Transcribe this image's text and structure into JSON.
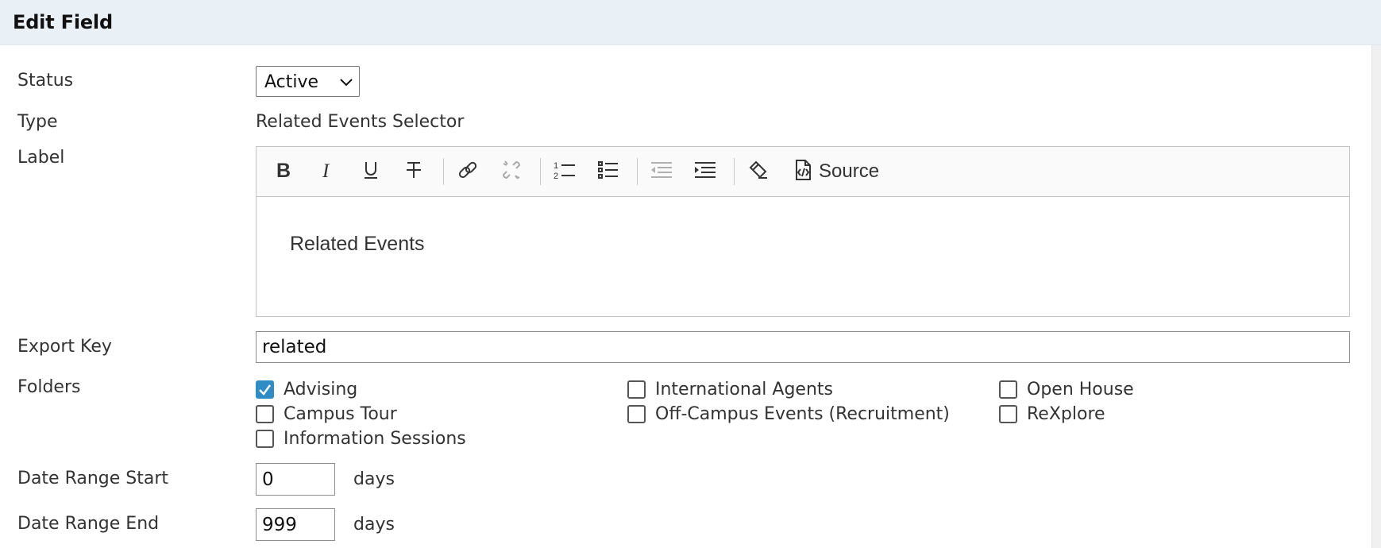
{
  "header": {
    "title": "Edit Field"
  },
  "status": {
    "label": "Status",
    "value": "Active",
    "accent": "#2f8cc4"
  },
  "type": {
    "label": "Type",
    "value": "Related Events Selector"
  },
  "label_field": {
    "label": "Label",
    "toolbar": {
      "buttons": [
        "bold",
        "italic",
        "underline",
        "strikethrough",
        "link",
        "unlink",
        "numbered-list",
        "bulleted-list",
        "outdent",
        "indent",
        "remove-format"
      ],
      "source_label": "Source"
    },
    "content": "Related Events"
  },
  "export_key": {
    "label": "Export Key",
    "value": "related"
  },
  "folders": {
    "label": "Folders",
    "items": [
      {
        "label": "Advising",
        "checked": true
      },
      {
        "label": "Campus Tour",
        "checked": false
      },
      {
        "label": "Information Sessions",
        "checked": false
      },
      {
        "label": "International Agents",
        "checked": false
      },
      {
        "label": "Off-Campus Events (Recruitment)",
        "checked": false
      },
      {
        "label": "Open House",
        "checked": false
      },
      {
        "label": "ReXplore",
        "checked": false
      }
    ]
  },
  "date_range_start": {
    "label": "Date Range Start",
    "value": "0",
    "unit": "days"
  },
  "date_range_end": {
    "label": "Date Range End",
    "value": "999",
    "unit": "days"
  }
}
